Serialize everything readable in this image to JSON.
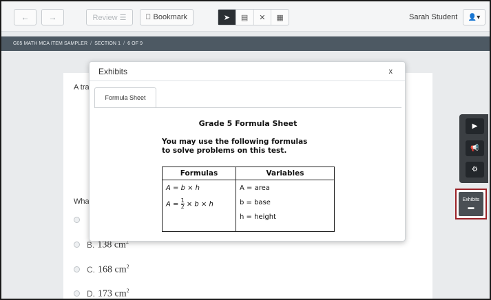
{
  "toolbar": {
    "back_label": "←",
    "forward_label": "→",
    "review_label": "Review ☰",
    "bookmark_label": "Bookmark",
    "tools": [
      "pointer",
      "note",
      "strikethrough",
      "calculator"
    ],
    "tool_glyphs": [
      "➤",
      "▤",
      "✕",
      "▦"
    ],
    "user_name": "Sarah Student",
    "user_menu_glyph": "👤▾"
  },
  "breadcrumb": {
    "test": "G05 MATH MCA ITEM SAMPLER",
    "section": "SECTION 1",
    "position": "6 OF 9",
    "separator": "/"
  },
  "item": {
    "stem_prefix": "A tra",
    "question_prefix": "Wha",
    "choices": [
      {
        "letter": "B.",
        "value": "138 cm",
        "exp": "2"
      },
      {
        "letter": "C.",
        "value": "168 cm",
        "exp": "2"
      },
      {
        "letter": "D.",
        "value": "173 cm",
        "exp": "2"
      }
    ]
  },
  "side_tools": {
    "play_glyph": "▶",
    "megaphone_glyph": "📢",
    "settings_glyph": "⚙",
    "exhibits_label": "Exhibits",
    "exhibits_glyph": "▬"
  },
  "modal": {
    "title": "Exhibits",
    "close_label": "x",
    "tab_label": "Formula Sheet",
    "sheet_title": "Grade 5 Formula Sheet",
    "intro_line1": "You may use the following formulas",
    "intro_line2": "to solve problems on this test.",
    "table_headers": [
      "Formulas",
      "Variables"
    ],
    "formula_1": "A = b × h",
    "formula_2_prefix": "A =",
    "formula_2_num": "1",
    "formula_2_den": "2",
    "formula_2_suffix": "× b × h",
    "variables": [
      "A = area",
      "b = base",
      "h = height"
    ]
  },
  "colors": {
    "crumb_bar": "#4d5963",
    "exhibits_border": "#9b2227",
    "active_tool": "#2b2f33"
  }
}
